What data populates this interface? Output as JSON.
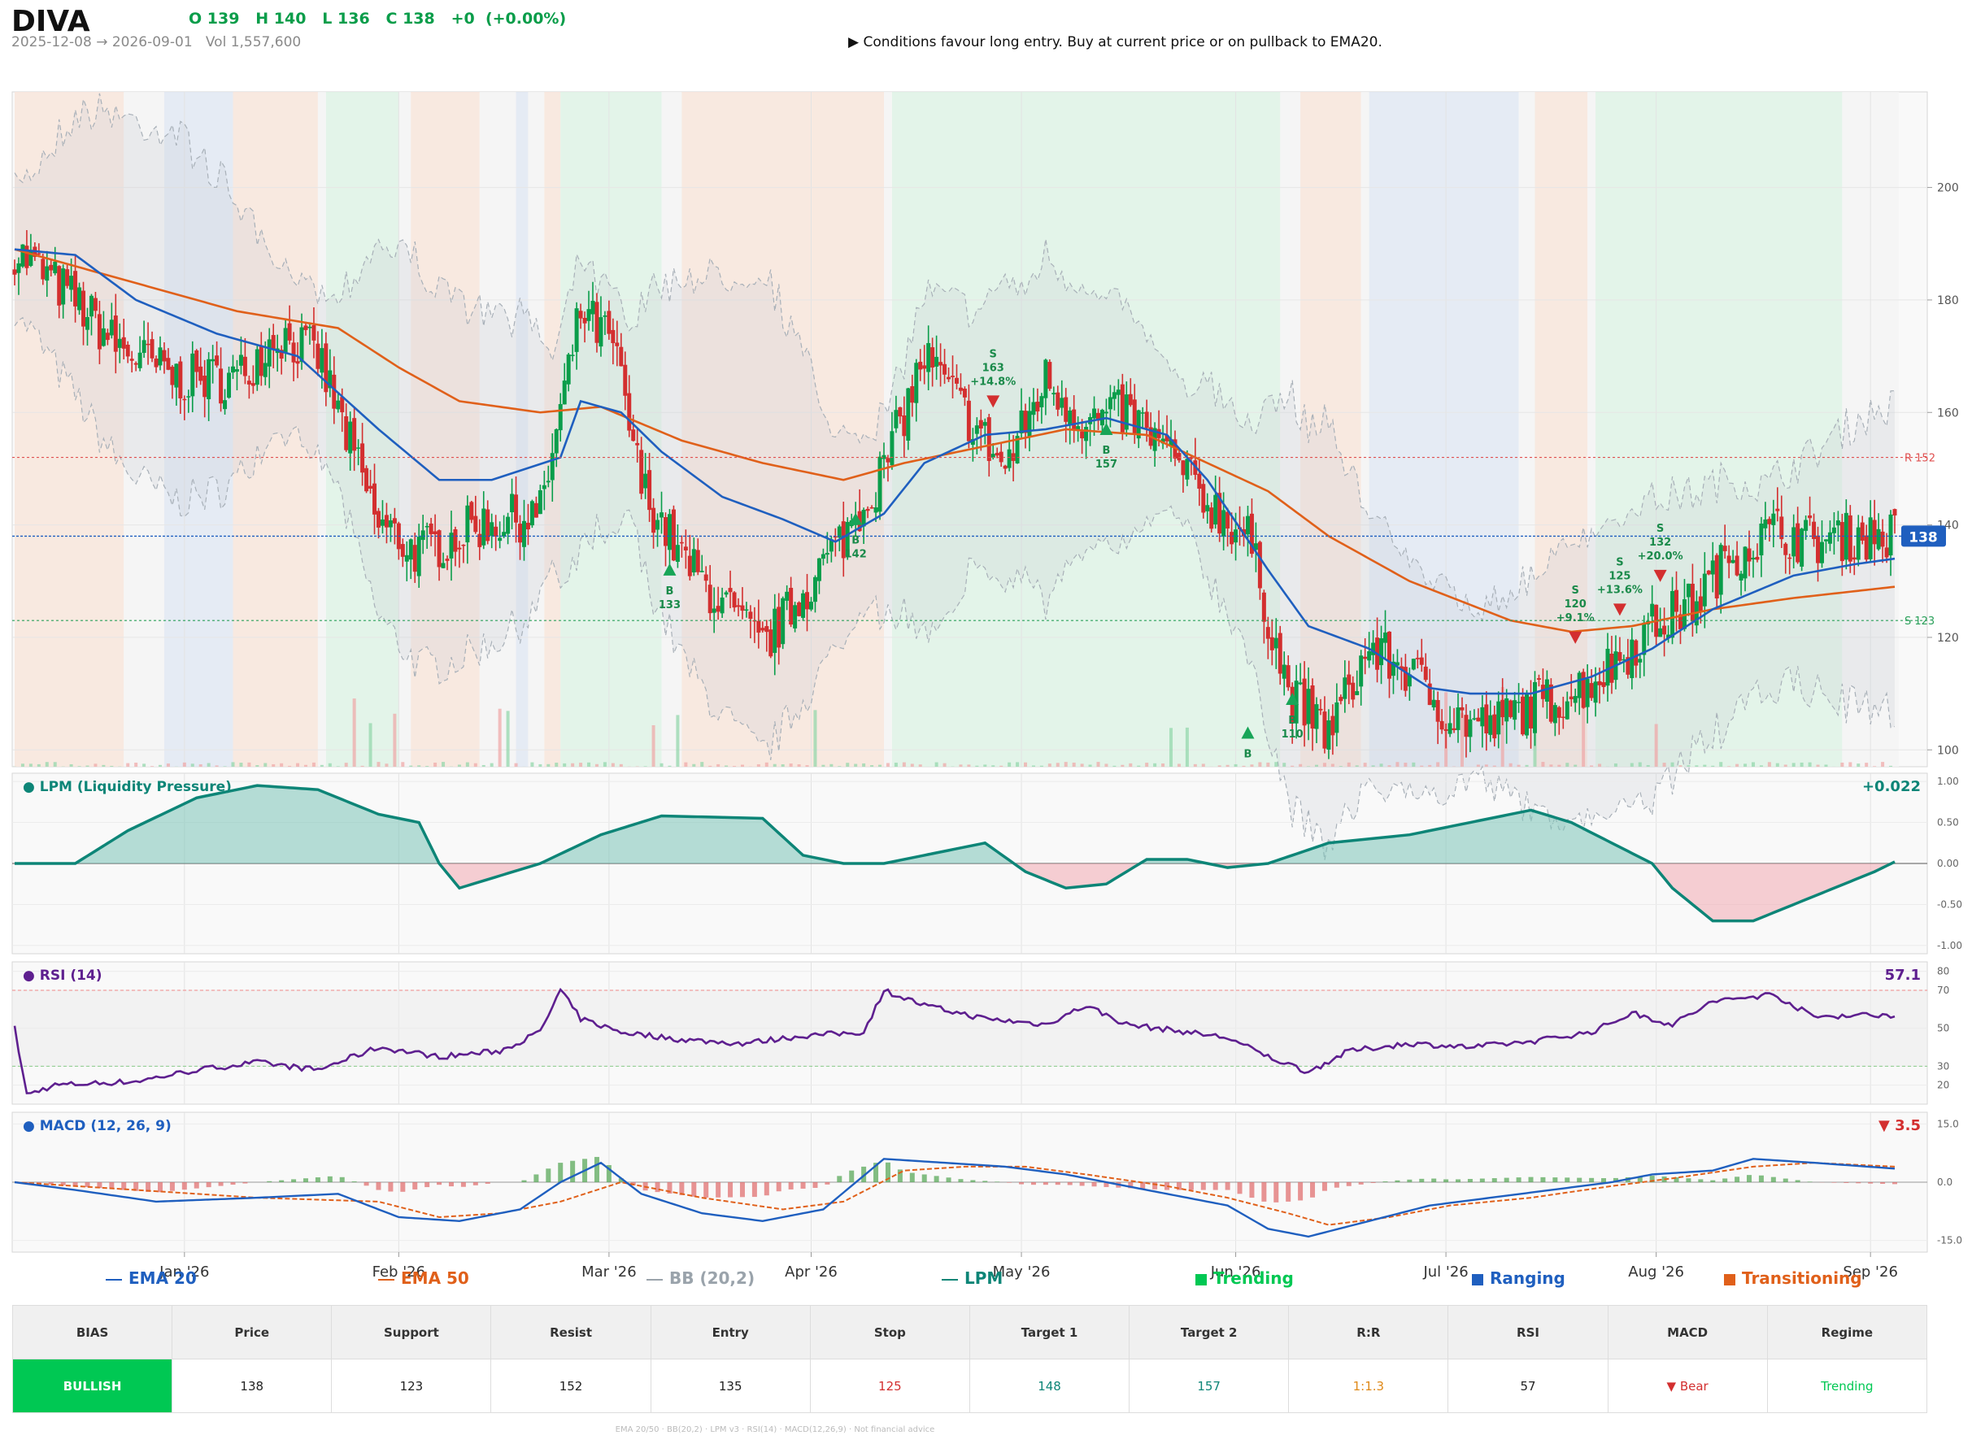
{
  "header": {
    "symbol": "DIVA",
    "ohlc": "O 139   H 140   L 136   C 138   +0  (+0.00%)",
    "range": "2025-12-08 → 2026-09-01   Vol 1,557,600",
    "signal": "▶  Conditions favour long entry. Buy at current price or on pullback to EMA20."
  },
  "panels": {
    "lpm": {
      "title": "● LPM (Liquidity Pressure)",
      "value": "+0.022",
      "ticks": [
        "1.00",
        "0.50",
        "0.00",
        "-0.50",
        "-1.00"
      ]
    },
    "rsi": {
      "title": "● RSI (14)",
      "value": "57.1",
      "ticks": [
        "80",
        "70",
        "50",
        "30",
        "20"
      ]
    },
    "macd": {
      "title": "● MACD (12, 26, 9)",
      "value": "▼ 3.5",
      "ticks": [
        "15.0",
        "0.0",
        "-15.0"
      ]
    }
  },
  "price_axis": {
    "ticks": [
      "200",
      "180",
      "160",
      "140",
      "120",
      "100"
    ],
    "current_badge": "138",
    "resistance_label": "R 152",
    "support_label": "S 123"
  },
  "x_axis": {
    "labels": [
      "Jan '26",
      "Feb '26",
      "Mar '26",
      "Apr '26",
      "May '26",
      "Jun '26",
      "Jul '26",
      "Aug '26",
      "Sep '26"
    ]
  },
  "markers": [
    {
      "kind": "buy",
      "label": "B\n133"
    },
    {
      "kind": "buy",
      "label": "B\n142"
    },
    {
      "kind": "sell",
      "label": "S\n163\n+14.8%"
    },
    {
      "kind": "buy",
      "label": "B\n157"
    },
    {
      "kind": "buy",
      "label": "B"
    },
    {
      "kind": "buy",
      "label": "B\n110"
    },
    {
      "kind": "sell",
      "label": "S\n120\n+9.1%"
    },
    {
      "kind": "sell",
      "label": "S\n125\n+13.6%"
    },
    {
      "kind": "sell",
      "label": "S\n132\n+20.0%"
    }
  ],
  "legend": {
    "ema20": "EMA 20",
    "ema50": "EMA 50",
    "bb": "BB (20,2)",
    "lpm": "LPM",
    "trending": "Trending",
    "ranging": "Ranging",
    "transitioning": "Transitioning"
  },
  "table": {
    "headers": [
      "BIAS",
      "Price",
      "Support",
      "Resist",
      "Entry",
      "Stop",
      "Target 1",
      "Target 2",
      "R:R",
      "RSI",
      "MACD",
      "Regime"
    ],
    "values": [
      "BULLISH",
      "138",
      "123",
      "152",
      "135",
      "125",
      "148",
      "157",
      "1:1.3",
      "57",
      "▼ Bear",
      "Trending"
    ]
  },
  "footer": "EMA 20/50  ·  BB(20,2)  ·  LPM v3  ·  RSI(14)  ·  MACD(12,26,9)  ·  Not financial advice",
  "colors": {
    "up": "#0a9d4a",
    "down": "#d32f2f",
    "ema20": "#1f5fbf",
    "ema50": "#e0601a",
    "lpm": "#0d8577",
    "rsi": "#5e1f8f",
    "macd": "#1f5fbf",
    "signal": "#e0601a",
    "trending": "#0a9d4a",
    "ranging": "#1f5fbf",
    "transitioning": "#e0601a",
    "bias_bg": "#00c853"
  },
  "chart_data": {
    "type": "candlestick",
    "series_keypoints": {
      "close": [
        [
          0,
          189
        ],
        [
          15,
          180
        ],
        [
          25,
          172
        ],
        [
          40,
          166
        ],
        [
          55,
          166
        ],
        [
          65,
          174
        ],
        [
          75,
          170
        ],
        [
          90,
          140
        ],
        [
          100,
          135
        ],
        [
          115,
          140
        ],
        [
          130,
          142
        ],
        [
          140,
          178
        ],
        [
          148,
          172
        ],
        [
          155,
          147
        ],
        [
          165,
          134
        ],
        [
          175,
          126
        ],
        [
          185,
          118
        ],
        [
          195,
          128
        ],
        [
          205,
          138
        ],
        [
          215,
          150
        ],
        [
          225,
          170
        ],
        [
          235,
          160
        ],
        [
          245,
          150
        ],
        [
          255,
          166
        ],
        [
          265,
          158
        ],
        [
          275,
          160
        ],
        [
          285,
          153
        ],
        [
          295,
          144
        ],
        [
          305,
          138
        ],
        [
          315,
          110
        ],
        [
          325,
          103
        ],
        [
          335,
          118
        ],
        [
          345,
          114
        ],
        [
          355,
          106
        ],
        [
          365,
          104
        ],
        [
          375,
          108
        ],
        [
          385,
          110
        ],
        [
          395,
          115
        ],
        [
          405,
          122
        ],
        [
          415,
          126
        ],
        [
          425,
          135
        ],
        [
          435,
          139
        ],
        [
          445,
          137
        ],
        [
          455,
          138
        ],
        [
          465,
          138
        ]
      ],
      "ema20": [
        [
          0,
          189
        ],
        [
          15,
          188
        ],
        [
          30,
          180
        ],
        [
          50,
          174
        ],
        [
          70,
          170
        ],
        [
          90,
          157
        ],
        [
          105,
          148
        ],
        [
          118,
          148
        ],
        [
          135,
          152
        ],
        [
          140,
          162
        ],
        [
          150,
          160
        ],
        [
          160,
          153
        ],
        [
          175,
          145
        ],
        [
          190,
          141
        ],
        [
          203,
          137
        ],
        [
          215,
          142
        ],
        [
          225,
          151
        ],
        [
          240,
          156
        ],
        [
          255,
          157
        ],
        [
          270,
          159
        ],
        [
          285,
          156
        ],
        [
          295,
          148
        ],
        [
          310,
          132
        ],
        [
          320,
          122
        ],
        [
          335,
          118
        ],
        [
          350,
          111
        ],
        [
          360,
          110
        ],
        [
          375,
          110
        ],
        [
          390,
          113
        ],
        [
          405,
          118
        ],
        [
          420,
          125
        ],
        [
          440,
          131
        ],
        [
          455,
          133
        ],
        [
          465,
          134
        ]
      ],
      "ema50": [
        [
          0,
          189
        ],
        [
          15,
          186
        ],
        [
          35,
          182
        ],
        [
          55,
          178
        ],
        [
          80,
          175
        ],
        [
          95,
          168
        ],
        [
          110,
          162
        ],
        [
          130,
          160
        ],
        [
          145,
          161
        ],
        [
          165,
          155
        ],
        [
          185,
          151
        ],
        [
          205,
          148
        ],
        [
          220,
          151
        ],
        [
          240,
          154
        ],
        [
          260,
          157
        ],
        [
          280,
          156
        ],
        [
          295,
          151
        ],
        [
          310,
          146
        ],
        [
          325,
          138
        ],
        [
          345,
          130
        ],
        [
          370,
          123
        ],
        [
          385,
          121
        ],
        [
          400,
          122
        ],
        [
          420,
          125
        ],
        [
          440,
          127
        ],
        [
          465,
          129
        ]
      ],
      "lpm": [
        [
          0,
          0
        ],
        [
          15,
          0
        ],
        [
          28,
          0.4
        ],
        [
          45,
          0.8
        ],
        [
          60,
          0.95
        ],
        [
          75,
          0.9
        ],
        [
          90,
          0.6
        ],
        [
          100,
          0.5
        ],
        [
          105,
          0
        ],
        [
          110,
          -0.3
        ],
        [
          120,
          -0.15
        ],
        [
          130,
          0
        ],
        [
          145,
          0.35
        ],
        [
          160,
          0.58
        ],
        [
          185,
          0.55
        ],
        [
          195,
          0.1
        ],
        [
          205,
          0
        ],
        [
          215,
          0
        ],
        [
          225,
          0.1
        ],
        [
          240,
          0.25
        ],
        [
          250,
          -0.1
        ],
        [
          260,
          -0.3
        ],
        [
          270,
          -0.25
        ],
        [
          280,
          0.05
        ],
        [
          290,
          0.05
        ],
        [
          300,
          -0.05
        ],
        [
          310,
          0
        ],
        [
          325,
          0.25
        ],
        [
          345,
          0.35
        ],
        [
          360,
          0.5
        ],
        [
          375,
          0.65
        ],
        [
          385,
          0.5
        ],
        [
          395,
          0.25
        ],
        [
          405,
          0
        ],
        [
          410,
          -0.3
        ],
        [
          420,
          -0.7
        ],
        [
          430,
          -0.7
        ],
        [
          440,
          -0.5
        ],
        [
          450,
          -0.3
        ],
        [
          460,
          -0.1
        ],
        [
          465,
          0.02
        ]
      ],
      "rsi": [
        [
          0,
          50
        ],
        [
          3,
          15
        ],
        [
          10,
          20
        ],
        [
          30,
          22
        ],
        [
          45,
          28
        ],
        [
          60,
          32
        ],
        [
          75,
          28
        ],
        [
          90,
          40
        ],
        [
          105,
          35
        ],
        [
          120,
          38
        ],
        [
          130,
          48
        ],
        [
          135,
          70
        ],
        [
          140,
          55
        ],
        [
          150,
          48
        ],
        [
          165,
          44
        ],
        [
          180,
          42
        ],
        [
          195,
          46
        ],
        [
          210,
          48
        ],
        [
          215,
          70
        ],
        [
          225,
          62
        ],
        [
          240,
          55
        ],
        [
          255,
          52
        ],
        [
          265,
          62
        ],
        [
          275,
          52
        ],
        [
          290,
          48
        ],
        [
          300,
          45
        ],
        [
          310,
          35
        ],
        [
          320,
          27
        ],
        [
          330,
          38
        ],
        [
          345,
          42
        ],
        [
          360,
          40
        ],
        [
          375,
          43
        ],
        [
          390,
          48
        ],
        [
          400,
          58
        ],
        [
          410,
          52
        ],
        [
          420,
          64
        ],
        [
          435,
          68
        ],
        [
          445,
          56
        ],
        [
          455,
          57
        ],
        [
          465,
          57
        ]
      ],
      "macd": [
        [
          0,
          0
        ],
        [
          15,
          -2
        ],
        [
          35,
          -5
        ],
        [
          60,
          -4
        ],
        [
          80,
          -3
        ],
        [
          95,
          -9
        ],
        [
          110,
          -10
        ],
        [
          125,
          -7
        ],
        [
          135,
          0
        ],
        [
          145,
          5
        ],
        [
          155,
          -3
        ],
        [
          170,
          -8
        ],
        [
          185,
          -10
        ],
        [
          200,
          -7
        ],
        [
          215,
          6
        ],
        [
          230,
          5
        ],
        [
          245,
          4
        ],
        [
          260,
          2
        ],
        [
          280,
          -2
        ],
        [
          300,
          -6
        ],
        [
          310,
          -12
        ],
        [
          320,
          -14
        ],
        [
          335,
          -10
        ],
        [
          350,
          -6
        ],
        [
          365,
          -4
        ],
        [
          380,
          -2
        ],
        [
          395,
          0
        ],
        [
          405,
          2
        ],
        [
          420,
          3
        ],
        [
          430,
          6
        ],
        [
          445,
          5
        ],
        [
          465,
          3.5
        ]
      ],
      "signal": [
        [
          0,
          0
        ],
        [
          30,
          -2
        ],
        [
          60,
          -4
        ],
        [
          90,
          -5
        ],
        [
          105,
          -9
        ],
        [
          120,
          -8
        ],
        [
          135,
          -5
        ],
        [
          150,
          0
        ],
        [
          170,
          -4
        ],
        [
          190,
          -7
        ],
        [
          205,
          -5
        ],
        [
          220,
          3
        ],
        [
          235,
          4
        ],
        [
          250,
          4
        ],
        [
          265,
          2
        ],
        [
          285,
          -1
        ],
        [
          300,
          -4
        ],
        [
          315,
          -8
        ],
        [
          325,
          -11
        ],
        [
          340,
          -9
        ],
        [
          355,
          -6
        ],
        [
          375,
          -4
        ],
        [
          395,
          -1
        ],
        [
          410,
          1
        ],
        [
          430,
          4
        ],
        [
          445,
          5
        ],
        [
          465,
          4
        ]
      ]
    },
    "bar_count": 466,
    "regimes": [
      {
        "from": 0,
        "to": 27,
        "type": "transitioning"
      },
      {
        "from": 27,
        "to": 37,
        "type": "none"
      },
      {
        "from": 37,
        "to": 54,
        "type": "ranging"
      },
      {
        "from": 54,
        "to": 75,
        "type": "transitioning"
      },
      {
        "from": 75,
        "to": 77,
        "type": "none"
      },
      {
        "from": 77,
        "to": 95,
        "type": "trending"
      },
      {
        "from": 95,
        "to": 98,
        "type": "none"
      },
      {
        "from": 98,
        "to": 115,
        "type": "transitioning"
      },
      {
        "from": 115,
        "to": 124,
        "type": "none"
      },
      {
        "from": 124,
        "to": 127,
        "type": "ranging"
      },
      {
        "from": 127,
        "to": 131,
        "type": "none"
      },
      {
        "from": 131,
        "to": 135,
        "type": "transitioning"
      },
      {
        "from": 135,
        "to": 160,
        "type": "trending"
      },
      {
        "from": 160,
        "to": 165,
        "type": "none"
      },
      {
        "from": 165,
        "to": 215,
        "type": "transitioning"
      },
      {
        "from": 215,
        "to": 217,
        "type": "none"
      },
      {
        "from": 217,
        "to": 313,
        "type": "trending"
      },
      {
        "from": 313,
        "to": 318,
        "type": "none"
      },
      {
        "from": 318,
        "to": 333,
        "type": "transitioning"
      },
      {
        "from": 333,
        "to": 335,
        "type": "none"
      },
      {
        "from": 335,
        "to": 372,
        "type": "ranging"
      },
      {
        "from": 372,
        "to": 376,
        "type": "none"
      },
      {
        "from": 376,
        "to": 389,
        "type": "transitioning"
      },
      {
        "from": 389,
        "to": 391,
        "type": "none"
      },
      {
        "from": 391,
        "to": 452,
        "type": "trending"
      },
      {
        "from": 452,
        "to": 466,
        "type": "none"
      }
    ],
    "y_range_price": [
      97,
      217
    ],
    "levels": {
      "resistance": 152,
      "support": 123,
      "current": 138
    },
    "y_range_lpm": [
      -1.1,
      1.1
    ],
    "y_range_rsi": [
      10,
      85
    ],
    "y_range_macd": [
      -18,
      18
    ],
    "month_bars": [
      42,
      95,
      147,
      197,
      249,
      302,
      354,
      406,
      459
    ],
    "marker_bars": [
      162,
      208,
      242,
      270,
      305,
      316,
      386,
      397,
      407
    ],
    "marker_prices": [
      132,
      141,
      162,
      157,
      103,
      109,
      120,
      125,
      131
    ]
  }
}
